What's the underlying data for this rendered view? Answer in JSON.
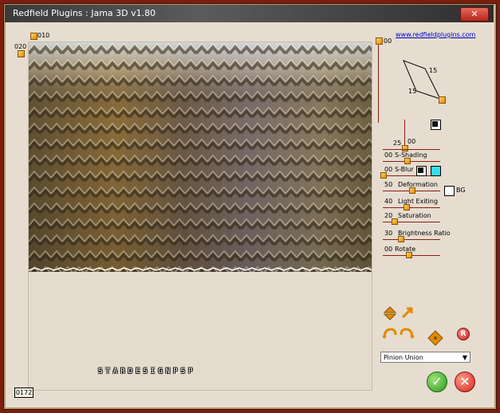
{
  "window": {
    "title": "Redfield Plugins : Jama 3D  v1.80",
    "close_label": "✕"
  },
  "preview": {
    "top_marker_label": "010",
    "left_marker_label": "020",
    "zoom_value": "0172",
    "watermark": "STARDESIGNPSP"
  },
  "link": "www.redfieldplugins.com",
  "rotation": {
    "top_value": "00",
    "angle_a": "15",
    "angle_b": "15"
  },
  "height": {
    "value_a": "25",
    "value_b": "00"
  },
  "params": [
    {
      "value": "00",
      "label": "S-Shading",
      "level": 0.42
    },
    {
      "value": "00",
      "label": "S-Blur",
      "level": 0.0
    },
    {
      "value": "50",
      "label": "Deformation",
      "level": 0.5
    },
    {
      "value": "40",
      "label": "Light Exiting",
      "level": 0.4
    },
    {
      "value": "20",
      "label": "Saturation",
      "level": 0.2
    },
    {
      "value": "30",
      "label": "Brightness Ratio",
      "level": 0.3
    },
    {
      "value": "00",
      "label": "Rotate",
      "level": 0.45
    }
  ],
  "bg_label": "BG",
  "colors": {
    "shading_swatch": "#111111",
    "blur_swatch": "#33e0e8",
    "accent": "#e18a00",
    "frame": "#7a1f10"
  },
  "preset": {
    "selected": "Pinion Union"
  },
  "icons": {
    "up_down": "up-down-arrows-icon",
    "diagonal": "diagonal-arrow-icon",
    "undo": "undo-arc-icon",
    "redo": "redo-arc-icon",
    "move": "move-cross-icon",
    "reset": "reset-r-icon",
    "ok": "ok-check-icon",
    "cancel": "cancel-x-icon"
  },
  "buttons": {
    "reset_label": "R",
    "ok_label": "✓",
    "cancel_label": "✕"
  }
}
